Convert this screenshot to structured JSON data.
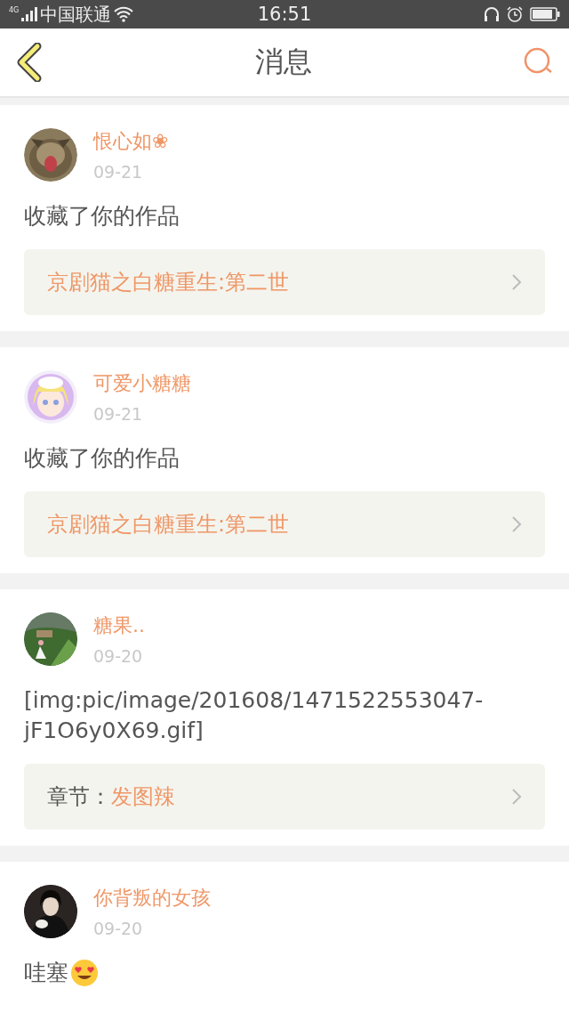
{
  "status_bar": {
    "network": "4G",
    "carrier": "中国联通",
    "time": "16:51"
  },
  "nav": {
    "title": "消息"
  },
  "messages": [
    {
      "user": "恨心如❀",
      "date": "09-21",
      "text": "收藏了你的作品",
      "link": {
        "kind": "work",
        "title": "京剧猫之白糖重生:第二世"
      }
    },
    {
      "user": "可爱小糖糖",
      "date": "09-21",
      "text": "收藏了你的作品",
      "link": {
        "kind": "work",
        "title": "京剧猫之白糖重生:第二世"
      }
    },
    {
      "user": "糖果..",
      "date": "09-20",
      "text": "[img:pic/image/201608/1471522553047-jF1O6y0X69.gif]",
      "link": {
        "kind": "chapter",
        "label": "章节：",
        "title": "发图辣"
      }
    },
    {
      "user": "你背叛的女孩",
      "date": "09-20",
      "text": "哇塞",
      "emoji": true
    }
  ]
}
